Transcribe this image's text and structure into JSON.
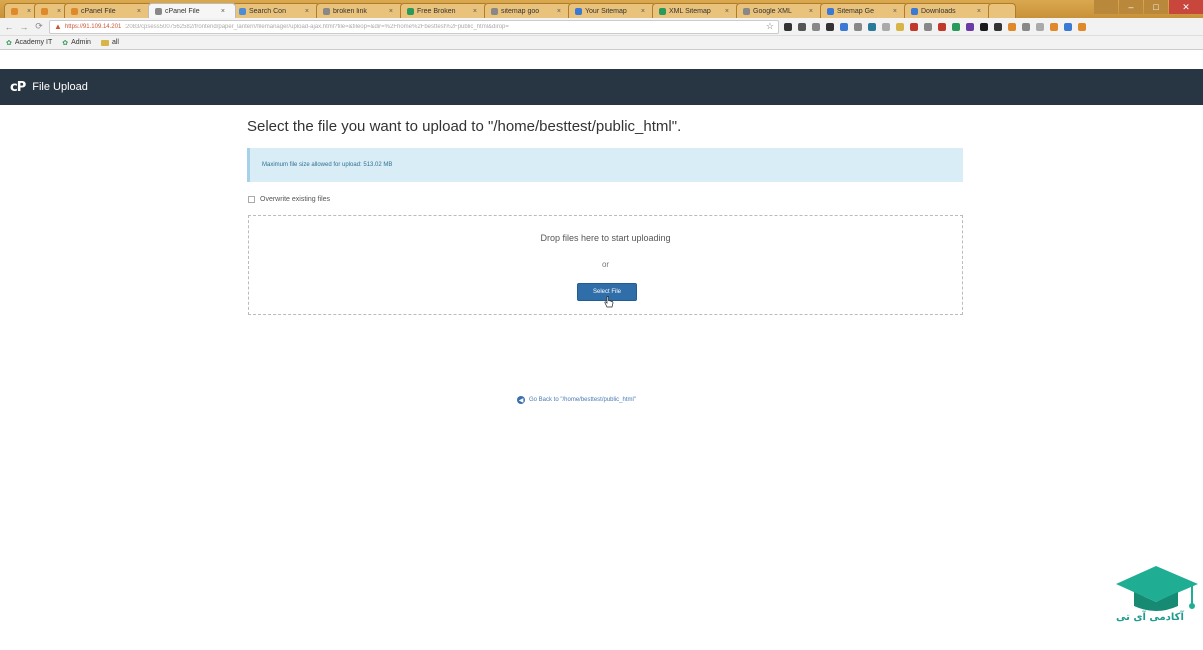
{
  "browser": {
    "tabs": [
      {
        "label": "",
        "active": false,
        "color": "#e0892a"
      },
      {
        "label": "",
        "active": false,
        "color": "#e0892a"
      },
      {
        "label": "cPanel File",
        "active": false,
        "color": "#e0892a"
      },
      {
        "label": "cPanel File",
        "active": true,
        "color": "#888888"
      },
      {
        "label": "Search Con",
        "active": false,
        "color": "#4a8cd6"
      },
      {
        "label": "broken link",
        "active": false,
        "color": "#888888"
      },
      {
        "label": "Free Broken",
        "active": false,
        "color": "#2a9a5a"
      },
      {
        "label": "sitemap goo",
        "active": false,
        "color": "#888888"
      },
      {
        "label": "Your Sitemap",
        "active": false,
        "color": "#3a7ad6"
      },
      {
        "label": "XML Sitemap",
        "active": false,
        "color": "#2a9a5a"
      },
      {
        "label": "Google XML",
        "active": false,
        "color": "#888888"
      },
      {
        "label": "Sitemap Ge",
        "active": false,
        "color": "#3a7ad6"
      },
      {
        "label": "Downloads",
        "active": false,
        "color": "#3a7ad6"
      }
    ],
    "address": {
      "host": "https://91.109.14.201",
      "url": ":2083/cpsess5007562582/frontend/paper_lantern/filemanager/upload-ajax.html?file=&fileop=&dir=%2Fhome%2Fbesttest%2Fpublic_html&dirop="
    },
    "extension_colors": [
      "#333333",
      "#555555",
      "#888888",
      "#333333",
      "#3a7ad6",
      "#888888",
      "#2a7a9a",
      "#aaaaaa",
      "#d8b547",
      "#c0392b",
      "#888888",
      "#c0392b",
      "#2a9a5a",
      "#6a3aa6",
      "#1a1a1a",
      "#333333",
      "#e0892a",
      "#888888",
      "#aaaaaa",
      "#e0892a",
      "#3a7ad6",
      "#e0892a"
    ],
    "bookmarks": [
      {
        "label": "Academy IT",
        "icon": "leaf-icon"
      },
      {
        "label": "Admin",
        "icon": "leaf-icon"
      },
      {
        "label": "all",
        "icon": "folder-icon"
      }
    ]
  },
  "header": {
    "logo": "cP",
    "title": "File Upload"
  },
  "main": {
    "title": "Select the file you want to upload to \"/home/besttest/public_html\".",
    "max_size_text": "Maximum file size allowed for upload: 513.02 MB",
    "overwrite_label": "Overwrite existing files",
    "drop_text": "Drop files here to start uploading",
    "or_text": "or",
    "select_button": "Select File",
    "go_back_text": "Go Back to \"/home/besttest/public_html\""
  },
  "watermark": {
    "text": "آکادمی آی تی"
  },
  "colors": {
    "header_bg": "#283542",
    "info_bg": "#d9edf7",
    "button": "#2f6ea8",
    "link": "#4a7ab5"
  }
}
